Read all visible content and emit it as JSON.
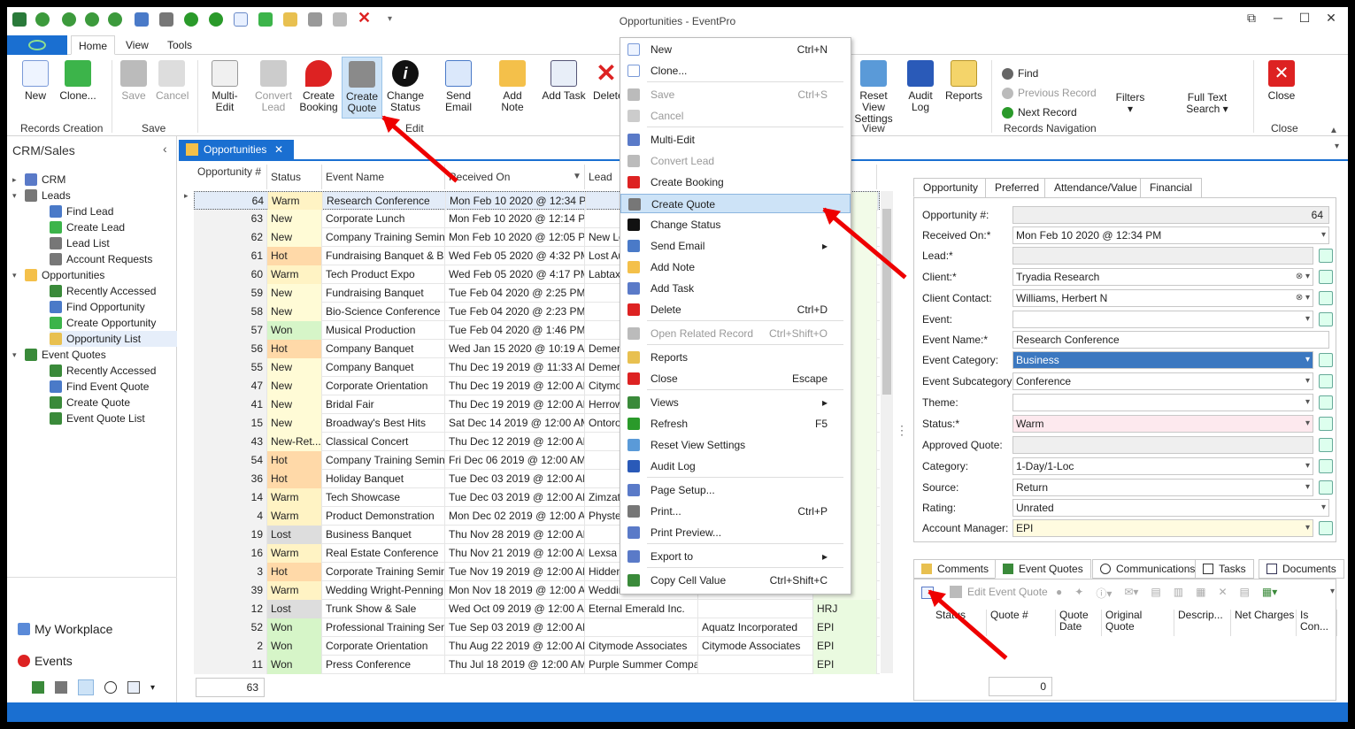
{
  "window": {
    "title": "Opportunities - EventPro"
  },
  "ribbon_tabs": [
    "Home",
    "View",
    "Tools"
  ],
  "ribbon": {
    "new": "New",
    "clone": "Clone...",
    "save": "Save",
    "cancel": "Cancel",
    "multi_edit": "Multi-Edit",
    "convert_lead_1": "Convert",
    "convert_lead_2": "Lead",
    "create_booking_1": "Create",
    "create_booking_2": "Booking",
    "create_quote_1": "Create",
    "create_quote_2": "Quote",
    "change_status_1": "Change",
    "change_status_2": "Status",
    "send_email": "Send Email",
    "add_note": "Add Note",
    "add_task": "Add Task",
    "delete": "Delete",
    "reset_view_1": "Reset View",
    "reset_view_2": "Settings",
    "audit_log_1": "Audit",
    "audit_log_2": "Log",
    "reports": "Reports",
    "find": "Find",
    "previous_record": "Previous Record",
    "next_record": "Next Record",
    "filters": "Filters",
    "full_text_1": "Full Text",
    "full_text_2": "Search",
    "close": "Close",
    "group_records_creation": "Records Creation",
    "group_save": "Save",
    "group_edit": "Edit",
    "group_view": "View",
    "group_records_navigation": "Records Navigation",
    "group_close": "Close"
  },
  "sidebar": {
    "title": "CRM/Sales",
    "items": [
      "CRM",
      "Leads",
      "Find Lead",
      "Create Lead",
      "Lead List",
      "Account Requests",
      "Opportunities",
      "Recently Accessed",
      "Find Opportunity",
      "Create Opportunity",
      "Opportunity List",
      "Event Quotes",
      "Recently Accessed",
      "Find Event Quote",
      "Create Quote",
      "Event Quote List"
    ],
    "workplace": "My Workplace",
    "events": "Events"
  },
  "doc_tab": "Opportunities",
  "grid": {
    "headers": [
      "Opportunity #",
      "Status",
      "Event Name",
      "Received On",
      "Lead"
    ],
    "rows": [
      [
        "64",
        "Warm",
        "Research Conference",
        "Mon Feb 10 2020 @ 12:34 PM",
        "",
        "",
        ""
      ],
      [
        "63",
        "New",
        "Corporate Lunch",
        "Mon Feb 10 2020 @ 12:14 PM",
        "",
        "",
        ""
      ],
      [
        "62",
        "New",
        "Company Training Seminar",
        "Mon Feb 10 2020 @ 12:05 PM",
        "New Le",
        "",
        ""
      ],
      [
        "61",
        "Hot",
        "Fundraising Banquet & Ball",
        "Wed Feb 05 2020 @ 4:32 PM",
        "Lost Au",
        "",
        ""
      ],
      [
        "60",
        "Warm",
        "Tech Product Expo",
        "Wed Feb 05 2020 @ 4:17 PM",
        "Labtax",
        "",
        ""
      ],
      [
        "59",
        "New",
        "Fundraising Banquet",
        "Tue Feb 04 2020 @ 2:25 PM",
        "",
        "",
        ""
      ],
      [
        "58",
        "New",
        "Bio-Science Conference",
        "Tue Feb 04 2020 @ 2:23 PM",
        "",
        "",
        ""
      ],
      [
        "57",
        "Won",
        "Musical Production",
        "Tue Feb 04 2020 @ 1:46 PM",
        "",
        "",
        ""
      ],
      [
        "56",
        "Hot",
        "Company Banquet",
        "Wed Jan 15 2020 @ 10:19 AM",
        "Demer",
        "",
        ""
      ],
      [
        "55",
        "New",
        "Company Banquet",
        "Thu Dec 19 2019 @ 11:33 AM",
        "Demer",
        "",
        ""
      ],
      [
        "47",
        "New",
        "Corporate Orientation",
        "Thu Dec 19 2019 @ 12:00 AM",
        "Citymo",
        "",
        ""
      ],
      [
        "41",
        "New",
        "Bridal Fair",
        "Thu Dec 19 2019 @ 12:00 AM",
        "Herrow",
        "",
        ""
      ],
      [
        "15",
        "New",
        "Broadway's Best Hits",
        "Sat Dec 14 2019 @ 12:00 AM",
        "Ontoro",
        "",
        ""
      ],
      [
        "43",
        "New-Ret...",
        "Classical Concert",
        "Thu Dec 12 2019 @ 12:00 AM",
        "",
        "",
        ""
      ],
      [
        "54",
        "Hot",
        "Company Training Seminar",
        "Fri Dec 06 2019 @ 12:00 AM",
        "",
        "",
        ""
      ],
      [
        "36",
        "Hot",
        "Holiday Banquet",
        "Tue Dec 03 2019 @ 12:00 AM",
        "",
        "",
        ""
      ],
      [
        "14",
        "Warm",
        "Tech Showcase",
        "Tue Dec 03 2019 @ 12:00 AM",
        "Zimzat",
        "",
        ""
      ],
      [
        "4",
        "Warm",
        "Product Demonstration",
        "Mon Dec 02 2019 @ 12:00 AM",
        "Physte",
        "",
        ""
      ],
      [
        "19",
        "Lost",
        "Business Banquet",
        "Thu Nov 28 2019 @ 12:00 AM",
        "",
        "",
        ""
      ],
      [
        "16",
        "Warm",
        "Real Estate Conference",
        "Thu Nov 21 2019 @ 12:00 AM",
        "Lexsa L",
        "",
        ""
      ],
      [
        "3",
        "Hot",
        "Corporate Training Seminar",
        "Tue Nov 19 2019 @ 12:00 AM",
        "Hidden",
        "",
        ""
      ],
      [
        "39",
        "Warm",
        "Wedding Wright-Penning",
        "Mon Nov 18 2019 @ 12:00 AM",
        "Weddir",
        "",
        ""
      ],
      [
        "12",
        "Lost",
        "Trunk Show & Sale",
        "Wed Oct 09 2019 @ 12:00 AM",
        "Eternal Emerald Inc.",
        "",
        "HRJ"
      ],
      [
        "52",
        "Won",
        "Professional Training Sem...",
        "Tue Sep 03 2019 @ 12:00 AM",
        "",
        "Aquatz Incorporated",
        "EPI"
      ],
      [
        "2",
        "Won",
        "Corporate Orientation",
        "Thu Aug 22 2019 @ 12:00 AM",
        "Citymode Associates",
        "Citymode Associates",
        "EPI"
      ],
      [
        "11",
        "Won",
        "Press Conference",
        "Thu Jul 18 2019 @ 12:00 AM",
        "Purple Summer Company",
        "",
        "EPI"
      ]
    ],
    "footer_count": "63"
  },
  "context_menu": [
    {
      "label": "New",
      "shortcut": "Ctrl+N",
      "disabled": false
    },
    {
      "label": "Clone...",
      "shortcut": "",
      "disabled": false
    },
    {
      "label": "Save",
      "shortcut": "Ctrl+S",
      "disabled": true
    },
    {
      "label": "Cancel",
      "shortcut": "",
      "disabled": true
    },
    {
      "label": "Multi-Edit",
      "shortcut": "",
      "disabled": false
    },
    {
      "label": "Convert Lead",
      "shortcut": "",
      "disabled": true
    },
    {
      "label": "Create Booking",
      "shortcut": "",
      "disabled": false
    },
    {
      "label": "Create Quote",
      "shortcut": "",
      "disabled": false
    },
    {
      "label": "Change Status",
      "shortcut": "",
      "disabled": false
    },
    {
      "label": "Send Email",
      "shortcut": "▸",
      "disabled": false
    },
    {
      "label": "Add Note",
      "shortcut": "",
      "disabled": false
    },
    {
      "label": "Add Task",
      "shortcut": "",
      "disabled": false
    },
    {
      "label": "Delete",
      "shortcut": "Ctrl+D",
      "disabled": false
    },
    {
      "label": "Open Related Record",
      "shortcut": "Ctrl+Shift+O",
      "disabled": true
    },
    {
      "label": "Reports",
      "shortcut": "",
      "disabled": false
    },
    {
      "label": "Close",
      "shortcut": "Escape",
      "disabled": false
    },
    {
      "label": "Views",
      "shortcut": "▸",
      "disabled": false
    },
    {
      "label": "Refresh",
      "shortcut": "F5",
      "disabled": false
    },
    {
      "label": "Reset View Settings",
      "shortcut": "",
      "disabled": false
    },
    {
      "label": "Audit Log",
      "shortcut": "",
      "disabled": false
    },
    {
      "label": "Page Setup...",
      "shortcut": "",
      "disabled": false
    },
    {
      "label": "Print...",
      "shortcut": "Ctrl+P",
      "disabled": false
    },
    {
      "label": "Print Preview...",
      "shortcut": "",
      "disabled": false
    },
    {
      "label": "Export to",
      "shortcut": "▸",
      "disabled": false
    },
    {
      "label": "Copy Cell Value",
      "shortcut": "Ctrl+Shift+C",
      "disabled": false
    }
  ],
  "detail": {
    "tabs": [
      "Opportunity",
      "Preferred",
      "Attendance/Value",
      "Financial"
    ],
    "fields": [
      {
        "label": "Opportunity #:",
        "value": "64"
      },
      {
        "label": "Received On:*",
        "value": "Mon Feb 10 2020 @ 12:34 PM"
      },
      {
        "label": "Lead:*",
        "value": ""
      },
      {
        "label": "Client:*",
        "value": "Tryadia Research"
      },
      {
        "label": "Client Contact:",
        "value": "Williams, Herbert N"
      },
      {
        "label": "Event:",
        "value": ""
      },
      {
        "label": "Event Name:*",
        "value": "Research Conference"
      },
      {
        "label": "Event Category:",
        "value": "Business"
      },
      {
        "label": "Event Subcategory:",
        "value": "Conference"
      },
      {
        "label": "Theme:",
        "value": ""
      },
      {
        "label": "Status:*",
        "value": "Warm"
      },
      {
        "label": "Approved Quote:",
        "value": ""
      },
      {
        "label": "Category:",
        "value": "1-Day/1-Loc"
      },
      {
        "label": "Source:",
        "value": "Return"
      },
      {
        "label": "Rating:",
        "value": "Unrated"
      },
      {
        "label": "Account Manager:",
        "value": "EPI"
      }
    ],
    "bottom_tabs": [
      "Comments",
      "Event Quotes",
      "Communications",
      "Tasks",
      "Documents"
    ],
    "edit_event_quote": "Edit Event Quote",
    "sub_headers": [
      "Status",
      "Quote #",
      "Quote Date",
      "Original Quote",
      "Descrip...",
      "Net Charges",
      "Is Con..."
    ],
    "sub_count": "0"
  },
  "colors": {
    "accent": "#1a6fd1",
    "hot": "#ffd9a8",
    "warm": "#fff3c4",
    "new": "#fffbd6",
    "won": "#d6f5c8",
    "lost": "#dddddd",
    "arrow": "#e00000"
  }
}
